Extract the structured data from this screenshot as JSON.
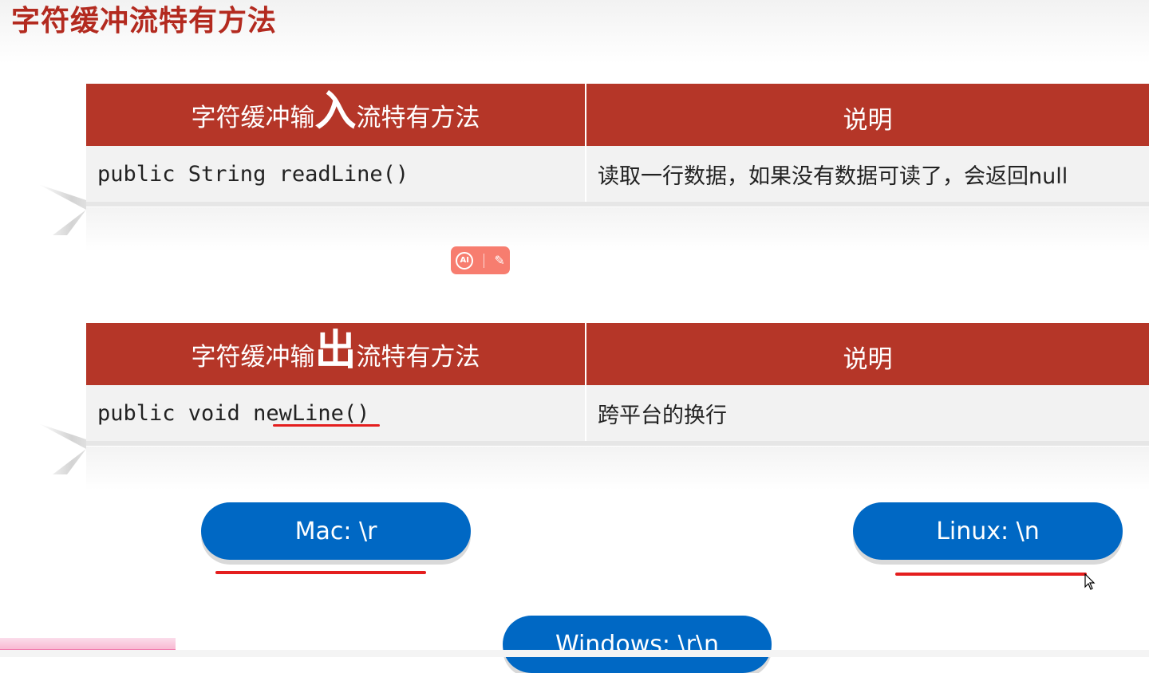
{
  "slide": {
    "title": "字符缓冲流特有方法"
  },
  "input_table": {
    "header": {
      "method_prefix": "字符缓冲输",
      "method_big": "入",
      "method_suffix": "流特有方法",
      "desc": "说明"
    },
    "row": {
      "method": "public String readLine()",
      "desc": "读取一行数据，如果没有数据可读了，会返回null"
    }
  },
  "output_table": {
    "header": {
      "method_prefix": "字符缓冲输",
      "method_big": "出",
      "method_suffix": "流特有方法",
      "desc": "说明"
    },
    "row": {
      "method": "public void newLine()",
      "desc": "跨平台的换行"
    }
  },
  "toolbar": {
    "ai_label": "AI",
    "magic": "✎"
  },
  "line_endings": {
    "mac": "Mac: \\r",
    "linux": "Linux: \\n",
    "windows": "Windows: \\r\\n"
  },
  "colors": {
    "accent_red": "#b53628",
    "title_red": "#b32a1f",
    "pill_blue": "#0068c4",
    "underline_red": "#e41e1e"
  }
}
